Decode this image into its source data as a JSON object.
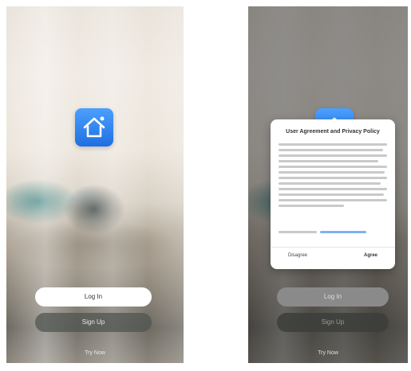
{
  "left_screen": {
    "login_label": "Log In",
    "signup_label": "Sign Up",
    "try_now_label": "Try Now"
  },
  "right_screen": {
    "login_label": "Log In",
    "signup_label": "Sign Up",
    "try_now_label": "Try Now",
    "modal": {
      "title": "User Agreement and Privacy Policy",
      "disagree_label": "Disagree",
      "agree_label": "Agree"
    }
  },
  "icons": {
    "app": "home-icon"
  },
  "colors": {
    "app_icon_top": "#4aa0ff",
    "app_icon_bottom": "#1f6fe0",
    "link": "#7fb1f0"
  }
}
